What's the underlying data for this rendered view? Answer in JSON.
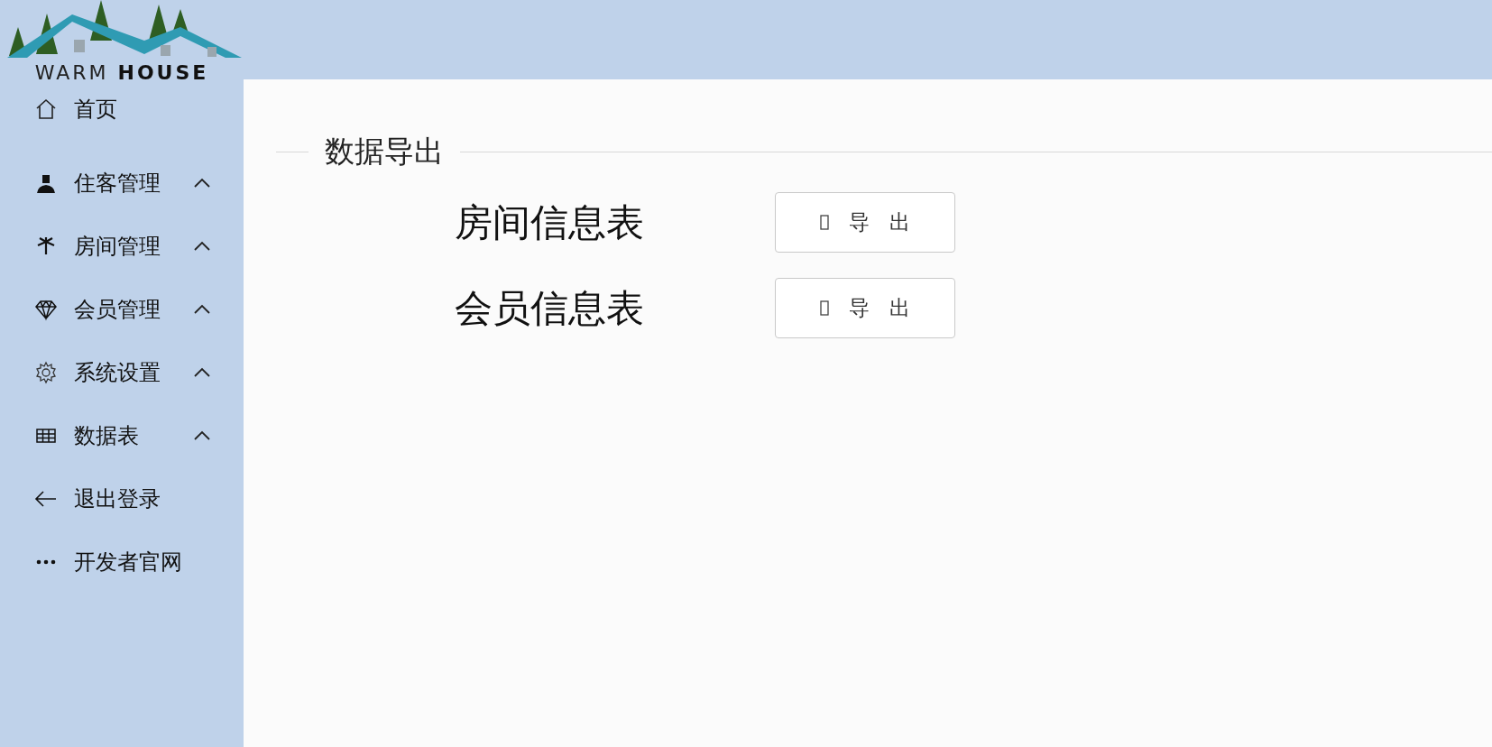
{
  "logo": {
    "text_light": "WARM ",
    "text_bold": "HOUSE"
  },
  "sidebar": {
    "items": [
      {
        "label": "首页",
        "kind": "link"
      },
      {
        "label": "住客管理",
        "kind": "submenu"
      },
      {
        "label": "房间管理",
        "kind": "submenu"
      },
      {
        "label": "会员管理",
        "kind": "submenu"
      },
      {
        "label": "系统设置",
        "kind": "submenu"
      },
      {
        "label": "数据表",
        "kind": "submenu"
      },
      {
        "label": "退出登录",
        "kind": "link"
      },
      {
        "label": "开发者官网",
        "kind": "link"
      }
    ]
  },
  "section": {
    "title": "数据导出"
  },
  "exports": [
    {
      "label": "房间信息表",
      "button": "导出"
    },
    {
      "label": "会员信息表",
      "button": "导出"
    }
  ]
}
